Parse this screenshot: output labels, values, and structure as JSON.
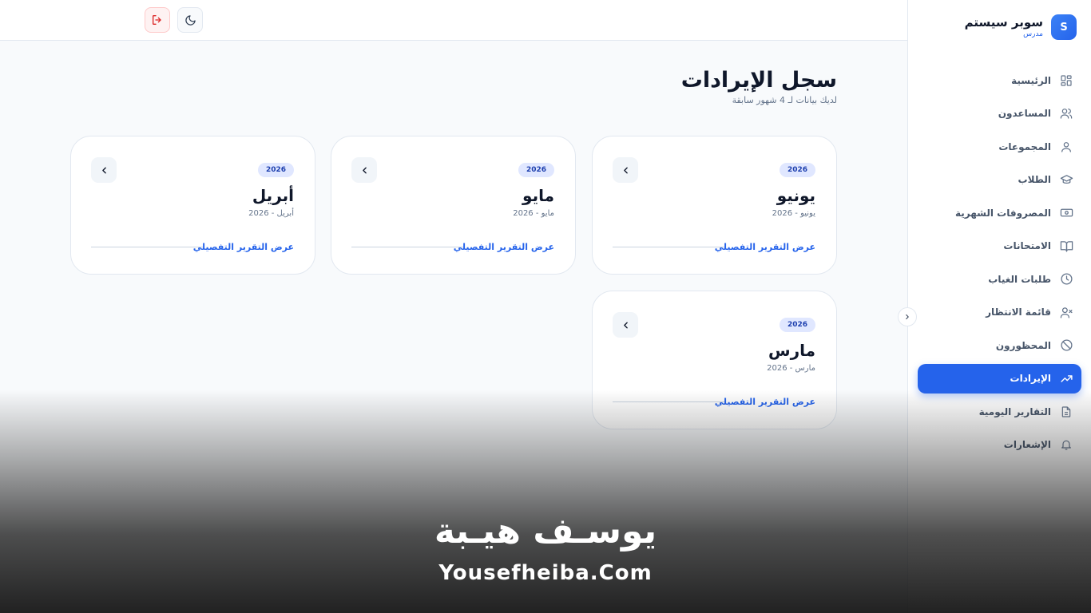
{
  "brand": {
    "logo_letter": "S",
    "title": "سوبر سيستم",
    "subtitle": "مدرس"
  },
  "sidebar": {
    "items": [
      {
        "label": "الرئيسية",
        "icon": "grid-icon",
        "active": false
      },
      {
        "label": "المساعدون",
        "icon": "users-icon",
        "active": false
      },
      {
        "label": "المجموعات",
        "icon": "user-group-icon",
        "active": false
      },
      {
        "label": "الطلاب",
        "icon": "graduation-cap-icon",
        "active": false
      },
      {
        "label": "المصروفات الشهرية",
        "icon": "banknote-icon",
        "active": false
      },
      {
        "label": "الامتحانات",
        "icon": "book-open-icon",
        "active": false
      },
      {
        "label": "طلبات الغياب",
        "icon": "clock-icon",
        "active": false
      },
      {
        "label": "قائمة الانتظار",
        "icon": "user-x-icon",
        "active": false
      },
      {
        "label": "المحظورون",
        "icon": "ban-icon",
        "active": false
      },
      {
        "label": "الإيرادات",
        "icon": "trending-up-icon",
        "active": true
      },
      {
        "label": "التقارير اليومية",
        "icon": "file-text-icon",
        "active": false
      },
      {
        "label": "الإشعارات",
        "icon": "bell-icon",
        "active": false
      }
    ]
  },
  "header": {
    "logout_icon": "logout-icon",
    "theme_icon": "moon-icon"
  },
  "page": {
    "title": "سجل الإيرادات",
    "subtitle": "لديك بيانات لـ 4 شهور سابقة"
  },
  "cards": [
    {
      "year": "2026",
      "month": "يونيو",
      "month_sub": "يونيو - 2026",
      "link": "عرض التقرير التفصيلي"
    },
    {
      "year": "2026",
      "month": "مايو",
      "month_sub": "مايو - 2026",
      "link": "عرض التقرير التفصيلي"
    },
    {
      "year": "2026",
      "month": "أبريل",
      "month_sub": "أبريل - 2026",
      "link": "عرض التقرير التفصيلي"
    },
    {
      "year": "2026",
      "month": "مارس",
      "month_sub": "مارس - 2026",
      "link": "عرض التقرير التفصيلي"
    }
  ],
  "watermark": {
    "arabic": "يوسـف هيـبة",
    "english": "Yousefheiba.Com"
  },
  "colors": {
    "accent": "#2563eb",
    "danger": "#dc2626",
    "text": "#0f172a",
    "muted": "#64748b"
  }
}
